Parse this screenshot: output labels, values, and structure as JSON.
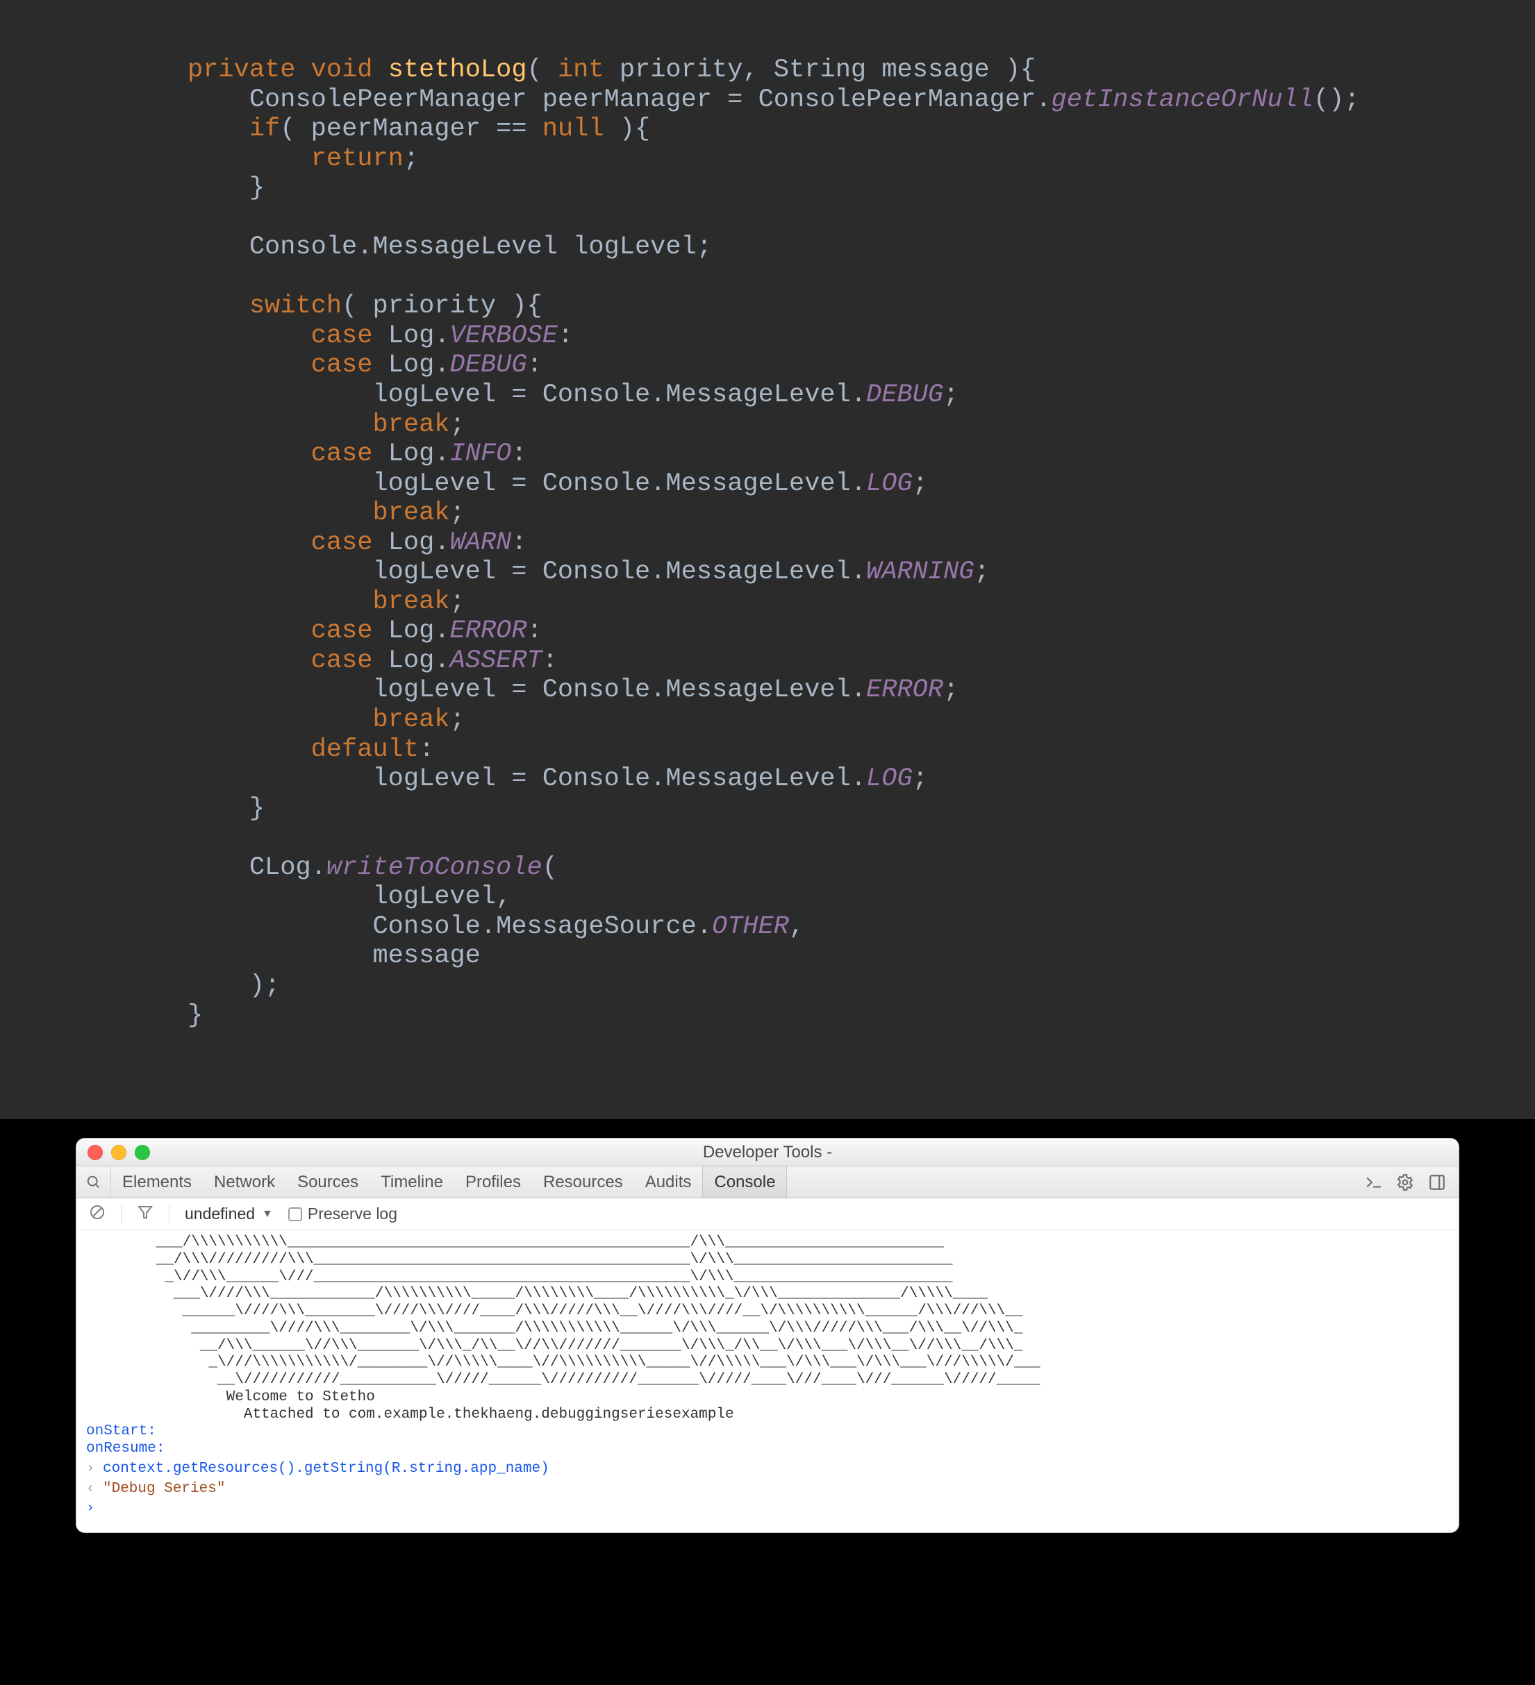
{
  "code": {
    "method_keyword_private": "private",
    "method_keyword_void": "void",
    "method_name": "stethoLog",
    "param_type_int": "int",
    "param_name_priority": "priority",
    "param_type_string": "String",
    "param_name_message": "message",
    "type_ConsolePeerManager": "ConsolePeerManager",
    "var_peerManager": "peerManager",
    "call_getInstanceOrNull": "getInstanceOrNull",
    "kw_if": "if",
    "kw_null": "null",
    "kw_return": "return",
    "type_Console": "Console",
    "type_MessageLevel": "MessageLevel",
    "var_logLevel": "logLevel",
    "kw_switch": "switch",
    "kw_case": "case",
    "type_Log": "Log",
    "const_VERBOSE": "VERBOSE",
    "const_DEBUG": "DEBUG",
    "const_INFO": "INFO",
    "const_WARN": "WARN",
    "const_ERROR": "ERROR",
    "const_ASSERT": "ASSERT",
    "const_LOG": "LOG",
    "const_WARNING": "WARNING",
    "kw_break": "break",
    "kw_default": "default",
    "type_CLog": "CLog",
    "call_writeToConsole": "writeToConsole",
    "type_MessageSource": "MessageSource",
    "const_OTHER": "OTHER"
  },
  "devtools": {
    "window_title": "Developer Tools -",
    "tabs": {
      "elements": "Elements",
      "network": "Network",
      "sources": "Sources",
      "timeline": "Timeline",
      "profiles": "Profiles",
      "resources": "Resources",
      "audits": "Audits",
      "console": "Console"
    },
    "filter": {
      "dropdown_label": "undefined",
      "preserve_log_label": "Preserve log"
    },
    "console": {
      "ascii": "        ___/\\\\\\\\\\\\\\\\\\\\\\______________________________________________/\\\\\\_________________________\n        __/\\\\\\/////////\\\\\\___________________________________________\\/\\\\\\_________________________\n         _\\//\\\\\\______\\///___________________________________________\\/\\\\\\_________________________\n          ___\\////\\\\\\____________/\\\\\\\\\\\\\\\\\\\\_____/\\\\\\\\\\\\\\\\____/\\\\\\\\\\\\\\\\\\\\_\\/\\\\\\______________/\\\\\\\\\\____\n           ______\\////\\\\\\________\\////\\\\\\////____/\\\\\\/////\\\\\\__\\////\\\\\\////__\\/\\\\\\\\\\\\\\\\\\\\______/\\\\\\///\\\\\\__\n            _________\\////\\\\\\________\\/\\\\\\_______/\\\\\\\\\\\\\\\\\\\\\\______\\/\\\\\\______\\/\\\\\\/////\\\\\\___/\\\\\\__\\//\\\\\\_\n             __/\\\\\\______\\//\\\\\\_______\\/\\\\\\_/\\\\__\\//\\\\///////_______\\/\\\\\\_/\\\\__\\/\\\\\\___\\/\\\\\\__\\//\\\\\\__/\\\\\\_\n              _\\///\\\\\\\\\\\\\\\\\\\\\\/________\\//\\\\\\\\\\____\\//\\\\\\\\\\\\\\\\\\\\_____\\//\\\\\\\\\\___\\/\\\\\\___\\/\\\\\\___\\///\\\\\\\\\\/___\n               __\\///////////___________\\/////______\\//////////_______\\/////____\\///____\\///______\\/////_____\n                Welcome to Stetho\n                  Attached to com.example.thekhaeng.debuggingseriesexample",
      "onStart": "onStart:",
      "onResume": "onResume:",
      "input_line": "context.getResources().getString(R.string.app_name)",
      "output_line": "\"Debug Series\""
    }
  }
}
